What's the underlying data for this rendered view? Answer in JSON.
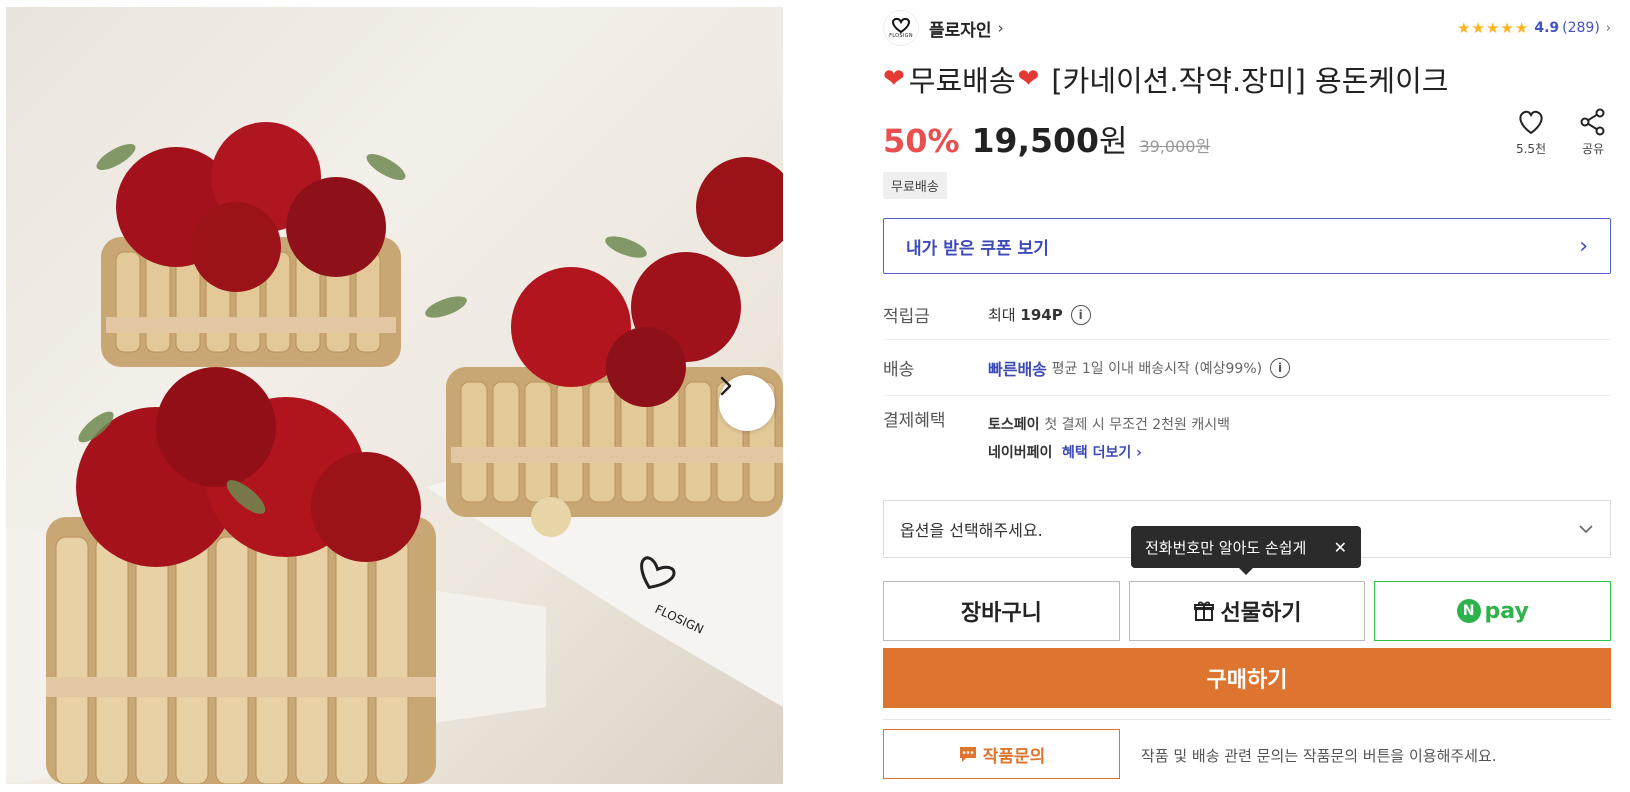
{
  "brand": {
    "logo_text": "FLOSIGN",
    "name": "플로자인",
    "chevron": "›"
  },
  "rating": {
    "stars": "★★★★★",
    "score": "4.9",
    "count": "(289)",
    "chevron": "›"
  },
  "title": {
    "heart_icon": "❤",
    "free_shipping": "무료배송",
    "name": "[카네이션.작약.장미] 용돈케이크"
  },
  "price": {
    "discount": "50%",
    "amount": "19,500",
    "currency": "원",
    "original": "39,000원"
  },
  "actions": {
    "like_count": "5.5천",
    "share_label": "공유"
  },
  "tag": "무료배송",
  "coupon": {
    "label": "내가 받은 쿠폰 보기",
    "chevron": "›"
  },
  "points": {
    "label": "적립금",
    "prefix": "최대",
    "value": "194P"
  },
  "shipping": {
    "label": "배송",
    "type": "빠른배송",
    "detail": "평균 1일 이내 배송시작 (예상99%)"
  },
  "benefits": {
    "label": "결제혜택",
    "toss_name": "토스페이",
    "toss_detail": "첫 결제 시 무조건 2천원 캐시백",
    "naver_name": "네이버페이",
    "naver_link": "혜택 더보기 ›"
  },
  "option": {
    "placeholder": "옵션을 선택해주세요."
  },
  "tooltip": {
    "text": "전화번호만 알아도 손쉽게",
    "close": "✕"
  },
  "buttons": {
    "cart": "장바구니",
    "gift": "선물하기",
    "npay_n": "N",
    "npay": "pay",
    "buy": "구매하기",
    "inquiry": "작품문의"
  },
  "inquiry_note": "작품 및 배송 관련 문의는 작품문의 버튼을 이용해주세요.",
  "image": {
    "watermark": "FLOSIGN",
    "next": "›"
  },
  "colors": {
    "accent": "#dd742f",
    "discount": "#e94f4f",
    "link_blue": "#3d4bb8",
    "npay_green": "#2db34a"
  }
}
